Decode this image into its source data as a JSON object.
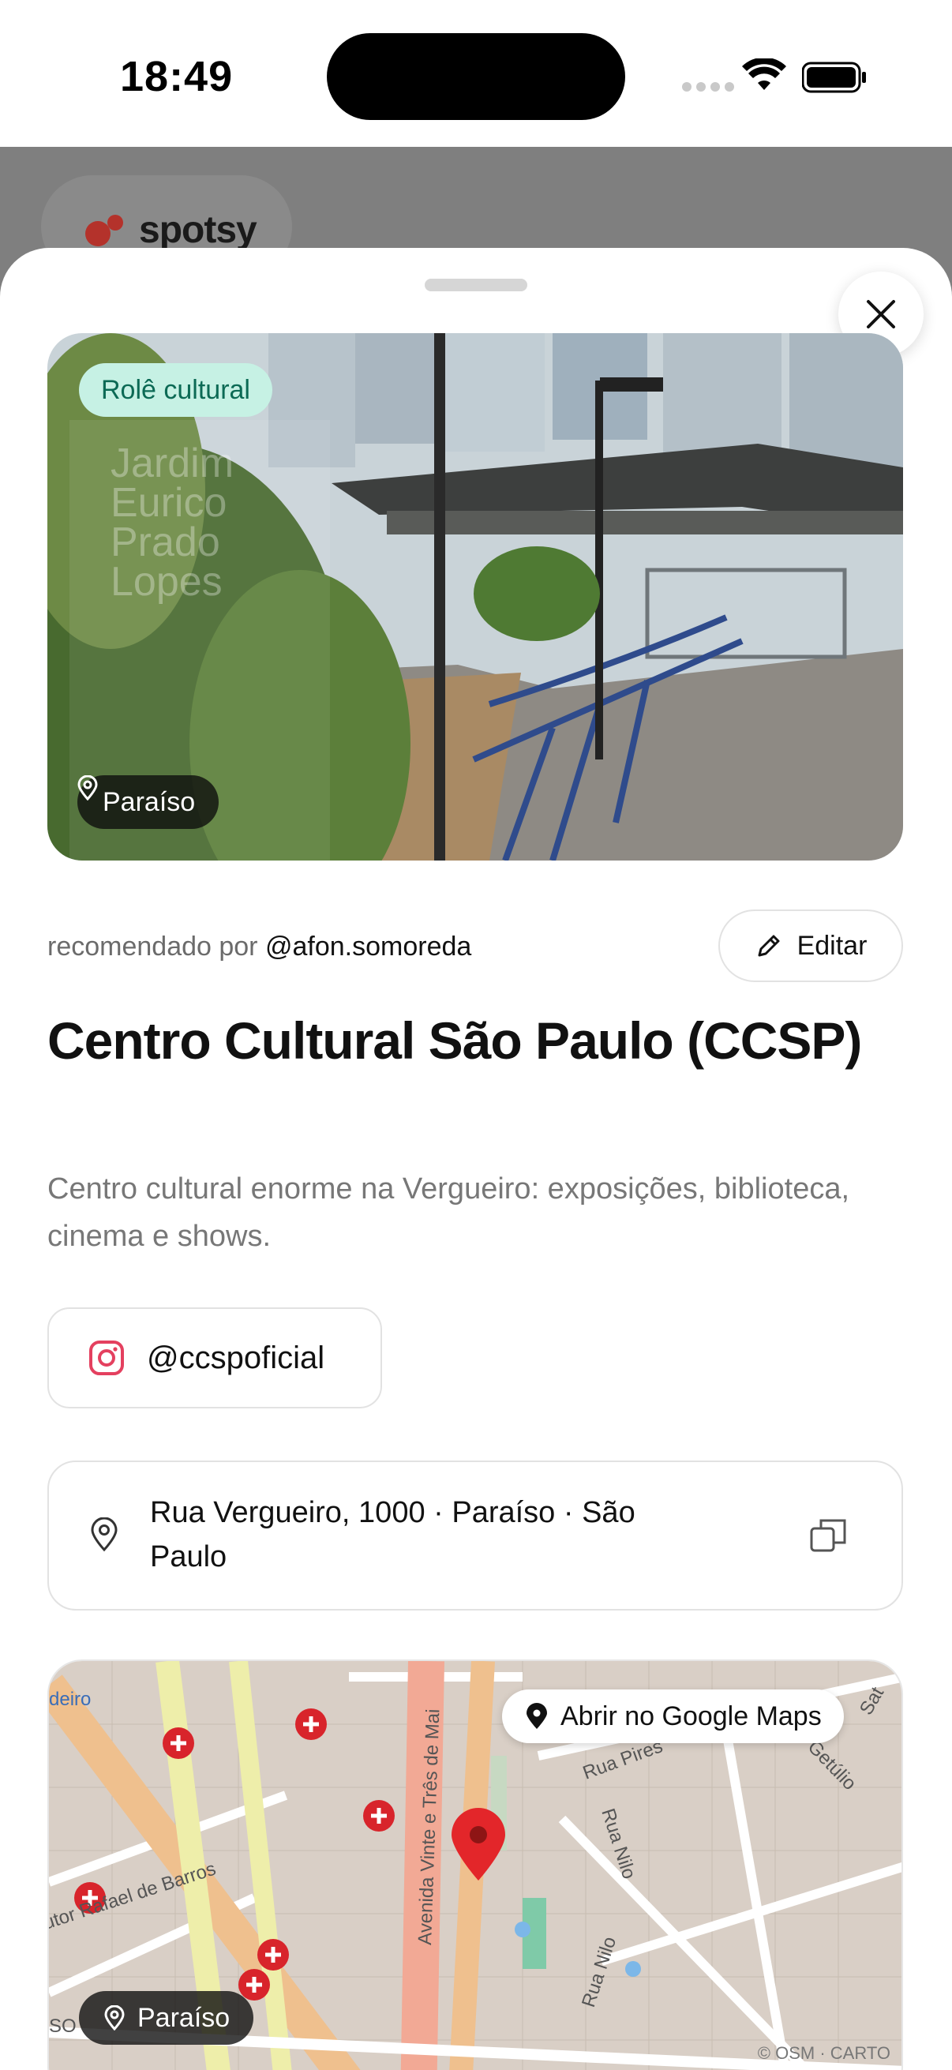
{
  "status_bar": {
    "time": "18:49"
  },
  "backdrop": {
    "brand": "spotsy"
  },
  "place": {
    "category": "Rolê cultural",
    "sign_text": [
      "Jardim",
      "Eurico",
      "Prado",
      "Lopes"
    ],
    "neighborhood": "Paraíso",
    "recommended_prefix": "recomendado por",
    "recommended_by": "@afon.somoreda",
    "edit_label": "Editar",
    "title": "Centro Cultural São Paulo (CCSP)",
    "description": "Centro cultural enorme na Vergueiro: exposições, biblioteca, cinema e shows.",
    "instagram": "@ccspoficial",
    "address": "Rua Vergueiro, 1000 · Paraíso · São Paulo"
  },
  "map": {
    "open_label": "Abrir no Google Maps",
    "neighborhood": "Paraíso",
    "credit": "© OSM · CARTO",
    "street_labels": [
      "deiro",
      "Avenida Vinte e Três de Mai",
      "Rua Pires",
      "Rua Nilo",
      "Rua Nilo",
      "utor Rafael de Barros",
      "Getúlio",
      "Sat",
      "SO"
    ]
  },
  "colors": {
    "accent_chip_bg": "#c6f1e4",
    "accent_chip_text": "#0c6a55",
    "pin_red": "#e3262a",
    "instagram": "#e4405f"
  }
}
